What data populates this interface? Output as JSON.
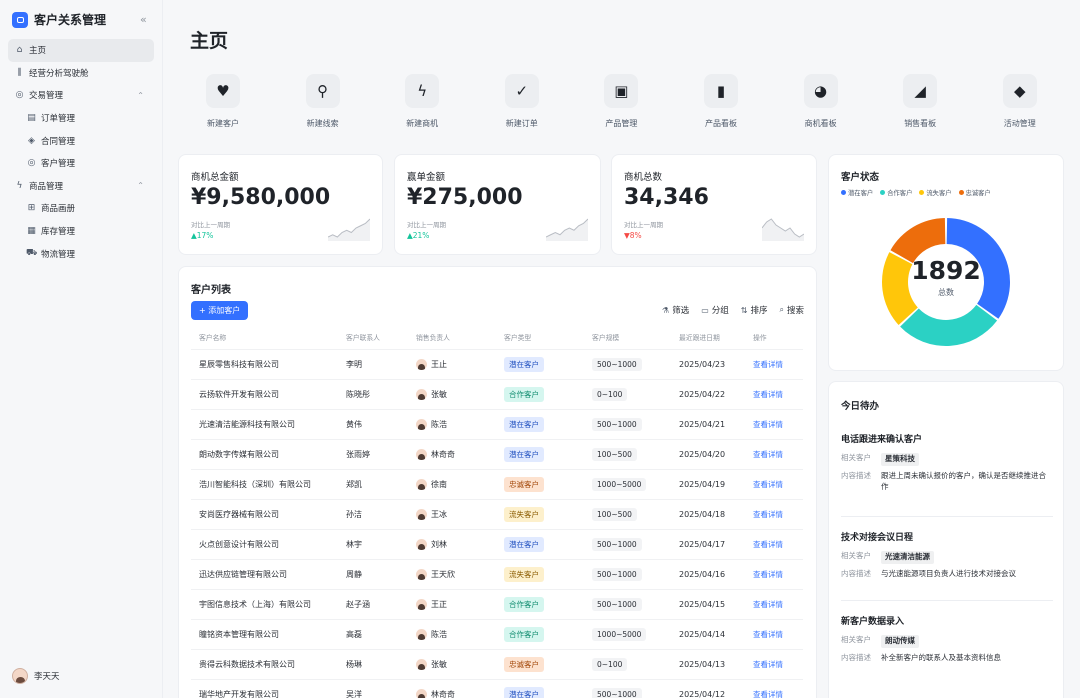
{
  "app": {
    "title": "客户关系管理",
    "collapse_icon": "double-chevron-left-icon"
  },
  "sidebar": {
    "items": [
      {
        "label": "主页",
        "icon": "home-icon",
        "glyph": "⌂",
        "level": 1,
        "active": true
      },
      {
        "label": "经营分析驾驶舱",
        "icon": "bar-chart-icon",
        "glyph": "⫼",
        "level": 1
      },
      {
        "label": "交易管理",
        "icon": "target-icon",
        "glyph": "◎",
        "level": 1,
        "caret": "⌃"
      },
      {
        "label": "订单管理",
        "icon": "order-icon",
        "glyph": "▤",
        "level": 2
      },
      {
        "label": "合同管理",
        "icon": "contract-icon",
        "glyph": "◈",
        "level": 2
      },
      {
        "label": "客户管理",
        "icon": "customer-icon",
        "glyph": "◎",
        "level": 2
      },
      {
        "label": "商品管理",
        "icon": "lightning-icon",
        "glyph": "ϟ",
        "level": 1,
        "caret": "⌃"
      },
      {
        "label": "商品画册",
        "icon": "grid-icon",
        "glyph": "⊞",
        "level": 2
      },
      {
        "label": "库存管理",
        "icon": "inventory-icon",
        "glyph": "▦",
        "level": 2
      },
      {
        "label": "物流管理",
        "icon": "truck-icon",
        "glyph": "⛟",
        "level": 2
      }
    ],
    "user": {
      "name": "李天天"
    }
  },
  "page": {
    "title": "主页"
  },
  "quick_actions": [
    {
      "label": "新建客户",
      "icon": "heart-icon",
      "glyph": "♥"
    },
    {
      "label": "新建线索",
      "icon": "bulb-icon",
      "glyph": "⚲"
    },
    {
      "label": "新建商机",
      "icon": "lightning-icon",
      "glyph": "ϟ"
    },
    {
      "label": "新建订单",
      "icon": "bookmark-check-icon",
      "glyph": "✓"
    },
    {
      "label": "产品管理",
      "icon": "package-icon",
      "glyph": "▣"
    },
    {
      "label": "产品看板",
      "icon": "bar-chart-icon",
      "glyph": "▮"
    },
    {
      "label": "商机看板",
      "icon": "pie-chart-icon",
      "glyph": "◕"
    },
    {
      "label": "销售看板",
      "icon": "trend-chart-icon",
      "glyph": "◢"
    },
    {
      "label": "活动管理",
      "icon": "gamepad-icon",
      "glyph": "◆"
    }
  ],
  "stats": [
    {
      "label": "商机总金额",
      "value": "¥9,580,000",
      "compare": "对比上一周期",
      "delta": "17%",
      "direction": "up",
      "arrow": "▲",
      "spark": [
        3,
        4,
        3,
        5,
        6,
        5,
        7,
        8,
        9,
        11
      ]
    },
    {
      "label": "赢单金额",
      "value": "¥275,000",
      "compare": "对比上一周期",
      "delta": "21%",
      "direction": "up",
      "arrow": "▲",
      "spark": [
        3,
        4,
        5,
        4,
        6,
        7,
        6,
        8,
        9,
        11
      ]
    },
    {
      "label": "商机总数",
      "value": "34,346",
      "compare": "对比上一周期",
      "delta": "8%",
      "direction": "down",
      "arrow": "▼",
      "spark": [
        6,
        8,
        9,
        7,
        6,
        5,
        6,
        4,
        3,
        4
      ]
    }
  ],
  "customer_list": {
    "title": "客户列表",
    "add_button": "+ 添加客户",
    "tools": [
      {
        "label": "筛选",
        "icon": "filter-icon",
        "glyph": "⚗"
      },
      {
        "label": "分组",
        "icon": "group-icon",
        "glyph": "▭"
      },
      {
        "label": "排序",
        "icon": "sort-icon",
        "glyph": "⇅"
      },
      {
        "label": "搜索",
        "icon": "search-icon",
        "glyph": "⌕"
      }
    ],
    "columns": [
      "客户名称",
      "客户联系人",
      "销售负责人",
      "客户类型",
      "客户规模",
      "最近跟进日期",
      "操作"
    ],
    "rows": [
      {
        "name": "星辰零售科技有限公司",
        "contact": "李明",
        "owner": "王止",
        "type": "潜在客户",
        "size": "500~1000",
        "date": "2025/04/23",
        "action": "查看详情"
      },
      {
        "name": "云扬软件开发有限公司",
        "contact": "陈晓彤",
        "owner": "张敏",
        "type": "合作客户",
        "size": "0~100",
        "date": "2025/04/22",
        "action": "查看详情"
      },
      {
        "name": "光速清洁能源科技有限公司",
        "contact": "黄伟",
        "owner": "陈浩",
        "type": "潜在客户",
        "size": "500~1000",
        "date": "2025/04/21",
        "action": "查看详情"
      },
      {
        "name": "朗动数字传媒有限公司",
        "contact": "张雨婷",
        "owner": "林奇奇",
        "type": "潜在客户",
        "size": "100~500",
        "date": "2025/04/20",
        "action": "查看详情"
      },
      {
        "name": "浩川智能科技（深圳）有限公司",
        "contact": "郑凯",
        "owner": "徐南",
        "type": "忠诚客户",
        "size": "1000~5000",
        "date": "2025/04/19",
        "action": "查看详情"
      },
      {
        "name": "安尚医疗器械有限公司",
        "contact": "孙洁",
        "owner": "王冰",
        "type": "流失客户",
        "size": "100~500",
        "date": "2025/04/18",
        "action": "查看详情"
      },
      {
        "name": "火点创意设计有限公司",
        "contact": "林宇",
        "owner": "刘林",
        "type": "潜在客户",
        "size": "500~1000",
        "date": "2025/04/17",
        "action": "查看详情"
      },
      {
        "name": "迅达供应链管理有限公司",
        "contact": "周静",
        "owner": "王天欣",
        "type": "流失客户",
        "size": "500~1000",
        "date": "2025/04/16",
        "action": "查看详情"
      },
      {
        "name": "宇图信息技术（上海）有限公司",
        "contact": "赵子涵",
        "owner": "王正",
        "type": "合作客户",
        "size": "500~1000",
        "date": "2025/04/15",
        "action": "查看详情"
      },
      {
        "name": "瞳铭资本管理有限公司",
        "contact": "高磊",
        "owner": "陈浩",
        "type": "合作客户",
        "size": "1000~5000",
        "date": "2025/04/14",
        "action": "查看详情"
      },
      {
        "name": "贵得云科数据技术有限公司",
        "contact": "杨琳",
        "owner": "张敏",
        "type": "忠诚客户",
        "size": "0~100",
        "date": "2025/04/13",
        "action": "查看详情"
      },
      {
        "name": "瑞华地产开发有限公司",
        "contact": "吴洋",
        "owner": "林奇奇",
        "type": "潜在客户",
        "size": "500~1000",
        "date": "2025/04/12",
        "action": "查看详情"
      }
    ]
  },
  "type_colors": {
    "潜在客户": {
      "bg": "#e1eaff",
      "fg": "#1f4fbf"
    },
    "合作客户": {
      "bg": "#d5f6ef",
      "fg": "#0d8a6d"
    },
    "流失客户": {
      "bg": "#fdf0cc",
      "fg": "#8a5b00"
    },
    "忠诚客户": {
      "bg": "#fde2cf",
      "fg": "#a14608"
    }
  },
  "chart_data": {
    "type": "pie",
    "title": "客户状态",
    "total": "1892",
    "total_label": "总数",
    "legend_position": "top",
    "categories": [
      "潜在客户",
      "合作客户",
      "流失客户",
      "忠诚客户"
    ],
    "values": [
      35,
      28,
      20,
      17
    ],
    "colors": [
      "#3370ff",
      "#2bd1c4",
      "#ffc60a",
      "#ed6d0c"
    ]
  },
  "todo": {
    "title": "今日待办",
    "items": [
      {
        "title": "电话跟进来确认客户",
        "customer_key": "相关客户",
        "customer": "星策科技",
        "desc_key": "内容描述",
        "desc": "跟进上周未确认报价的客户，确认是否继续推进合作"
      },
      {
        "title": "技术对接会议日程",
        "customer_key": "相关客户",
        "customer": "光速清洁能源",
        "desc_key": "内容描述",
        "desc": "与光速能源项目负责人进行技术对接会议"
      },
      {
        "title": "新客户数据录入",
        "customer_key": "相关客户",
        "customer": "朗动传媒",
        "desc_key": "内容描述",
        "desc": "补全新客户的联系人及基本资料信息"
      }
    ]
  }
}
